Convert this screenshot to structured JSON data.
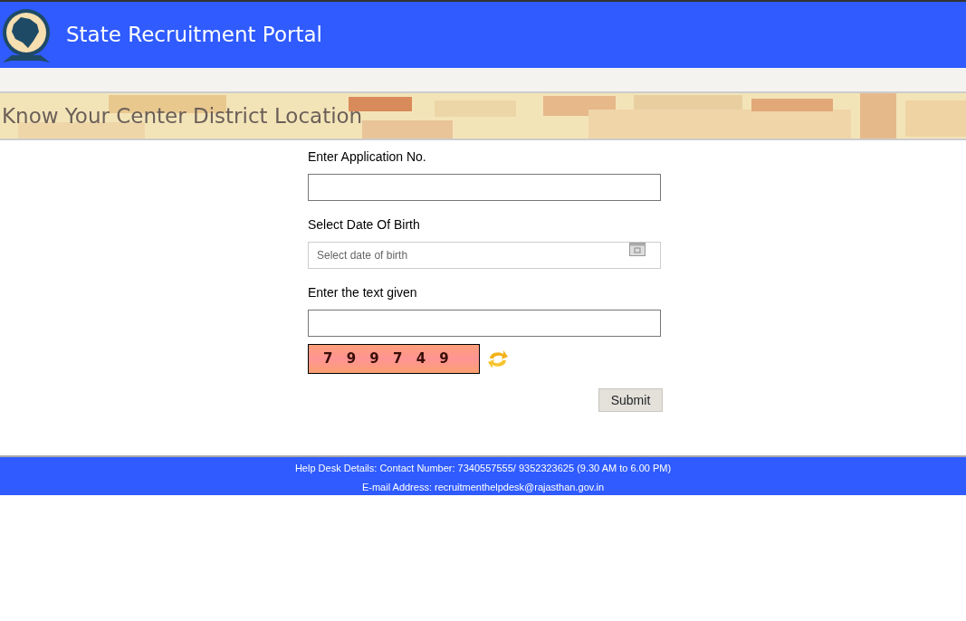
{
  "header": {
    "title": "State Recruitment Portal"
  },
  "page_title": "Know Your Center District Location",
  "form": {
    "fields": [
      {
        "kind": "text",
        "label": "Enter Application No."
      },
      {
        "kind": "date",
        "label": "Select Date Of Birth",
        "placeholder": "Select date of birth"
      },
      {
        "kind": "text",
        "label": "Enter the text given"
      }
    ],
    "captcha": "7 9 9 7 4 9",
    "submit": "Submit"
  },
  "footer": {
    "lines": [
      "Help Desk Details: Contact Number: 7340557555/ 9352323625 (9.30 AM to 6.00 PM)",
      "E-mail Address: recruitmenthelpdesk@rajasthan.gov.in"
    ]
  }
}
